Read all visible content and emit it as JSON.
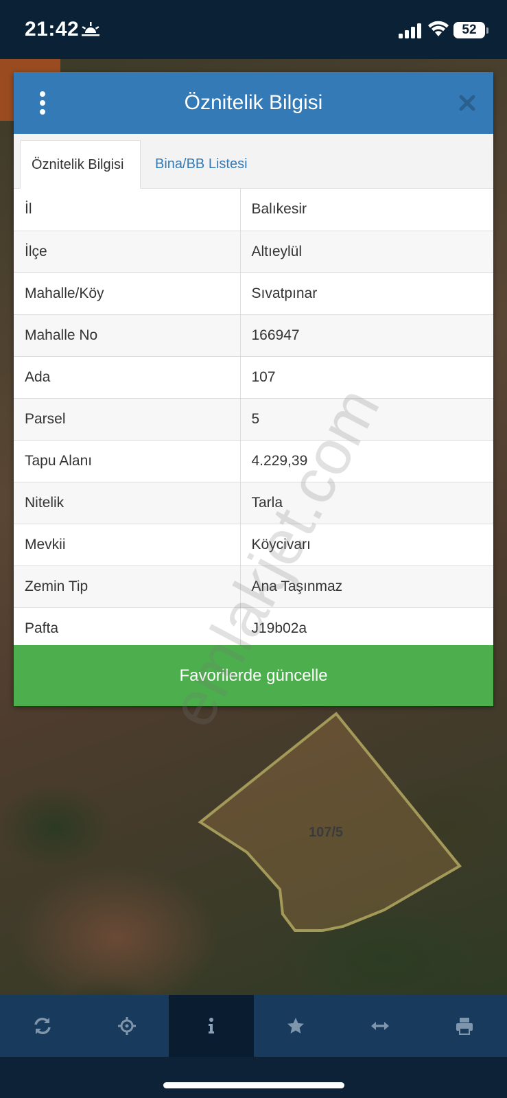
{
  "status_bar": {
    "time": "21:42",
    "battery": "52",
    "icons": [
      "sunset-icon",
      "cellular-signal-icon",
      "wifi-icon",
      "battery-icon"
    ]
  },
  "modal": {
    "title": "Öznitelik Bilgisi",
    "tabs": [
      {
        "label": "Öznitelik Bilgisi",
        "active": true
      },
      {
        "label": "Bina/BB Listesi",
        "active": false
      }
    ],
    "rows": [
      {
        "key": "İl",
        "value": "Balıkesir"
      },
      {
        "key": "İlçe",
        "value": "Altıeylül"
      },
      {
        "key": "Mahalle/Köy",
        "value": "Sıvatpınar"
      },
      {
        "key": "Mahalle No",
        "value": "166947"
      },
      {
        "key": "Ada",
        "value": "107"
      },
      {
        "key": "Parsel",
        "value": "5"
      },
      {
        "key": "Tapu Alanı",
        "value": "4.229,39"
      },
      {
        "key": "Nitelik",
        "value": "Tarla"
      },
      {
        "key": "Mevkii",
        "value": "Köycivarı"
      },
      {
        "key": "Zemin Tip",
        "value": "Ana Taşınmaz"
      },
      {
        "key": "Pafta",
        "value": "J19b02a"
      }
    ],
    "favorite_button": "Favorilerde güncelle"
  },
  "watermark": "emlakjet.com",
  "map": {
    "parcel_label": "107/5"
  },
  "toolbar": {
    "items": [
      {
        "icon": "refresh-icon",
        "active": false
      },
      {
        "icon": "locate-icon",
        "active": false
      },
      {
        "icon": "info-icon",
        "active": true
      },
      {
        "icon": "star-icon",
        "active": false
      },
      {
        "icon": "measure-icon",
        "active": false
      },
      {
        "icon": "print-icon",
        "active": false
      }
    ]
  },
  "colors": {
    "header_blue": "#337ab7",
    "button_green": "#4cae4c",
    "toolbar_bg": "#183a5c",
    "toolbar_active": "#0a1d30",
    "status_bar_bg": "#0b2135"
  }
}
